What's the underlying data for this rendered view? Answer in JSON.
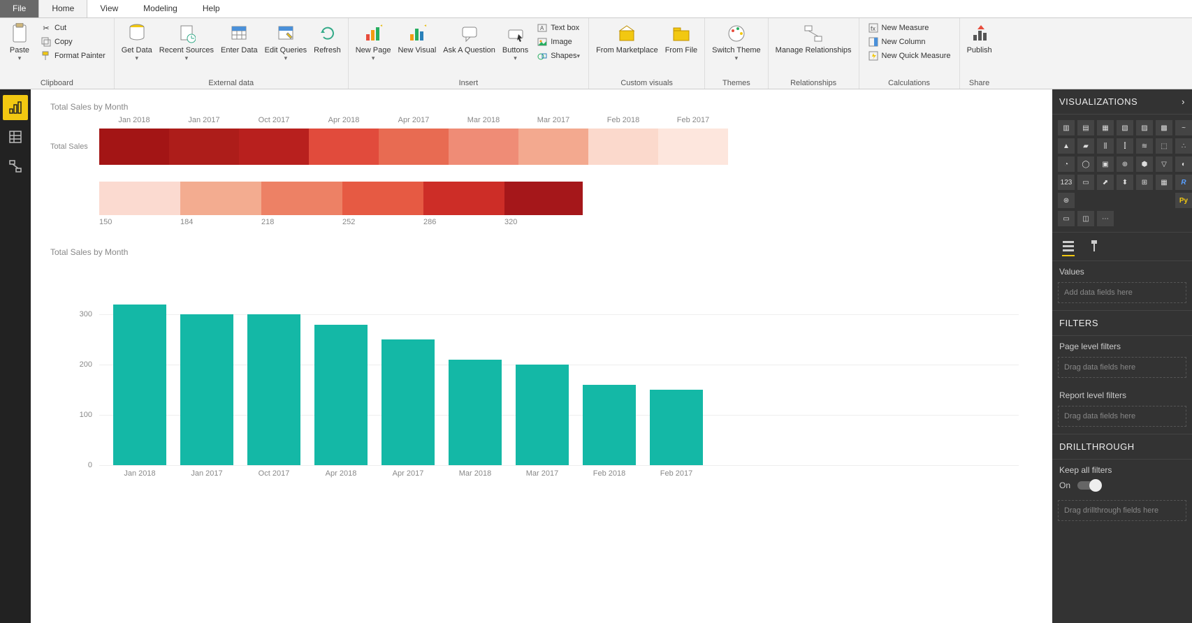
{
  "menubar": {
    "file": "File",
    "tabs": [
      "Home",
      "View",
      "Modeling",
      "Help"
    ],
    "active": "Home"
  },
  "ribbon": {
    "clipboard": {
      "label": "Clipboard",
      "paste": "Paste",
      "cut": "Cut",
      "copy": "Copy",
      "format_painter": "Format Painter"
    },
    "external": {
      "label": "External data",
      "get_data": "Get Data",
      "recent": "Recent Sources",
      "enter": "Enter Data",
      "edit": "Edit Queries",
      "refresh": "Refresh"
    },
    "insert": {
      "label": "Insert",
      "new_page": "New Page",
      "new_visual": "New Visual",
      "ask": "Ask A Question",
      "buttons": "Buttons",
      "textbox": "Text box",
      "image": "Image",
      "shapes": "Shapes"
    },
    "custom": {
      "label": "Custom visuals",
      "marketplace": "From Marketplace",
      "file": "From File"
    },
    "themes": {
      "label": "Themes",
      "switch": "Switch Theme"
    },
    "relationships": {
      "label": "Relationships",
      "manage": "Manage Relationships"
    },
    "calc": {
      "label": "Calculations",
      "measure": "New Measure",
      "column": "New Column",
      "quick": "New Quick Measure"
    },
    "share": {
      "label": "Share",
      "publish": "Publish"
    }
  },
  "charts": {
    "heatmap": {
      "title": "Total Sales by Month",
      "ylabel": "Total Sales",
      "categories": [
        "Jan 2018",
        "Jan 2017",
        "Oct 2017",
        "Apr 2018",
        "Apr 2017",
        "Mar 2018",
        "Mar 2017",
        "Feb 2018",
        "Feb 2017"
      ],
      "colors": [
        "#a31515",
        "#ad1d1a",
        "#b8201e",
        "#e14b3c",
        "#e86b52",
        "#ef8c76",
        "#f3a98f",
        "#fbd9cc",
        "#fde6dd"
      ],
      "legend_ticks": [
        "150",
        "184",
        "218",
        "252",
        "286",
        "320"
      ],
      "legend_colors": [
        "#fbdad0",
        "#f3ac90",
        "#ed8165",
        "#e65a43",
        "#cd2d27",
        "#a5171a"
      ]
    },
    "bar": {
      "title": "Total Sales by Month",
      "yaxis": [
        0,
        100,
        200,
        300
      ],
      "ymax": 320,
      "color": "#14b8a6"
    }
  },
  "chart_data": [
    {
      "type": "heatmap",
      "title": "Total Sales by Month",
      "categories": [
        "Jan 2018",
        "Jan 2017",
        "Oct 2017",
        "Apr 2018",
        "Apr 2017",
        "Mar 2018",
        "Mar 2017",
        "Feb 2018",
        "Feb 2017"
      ],
      "series": [
        {
          "name": "Total Sales",
          "values": [
            320,
            300,
            300,
            280,
            250,
            210,
            200,
            160,
            150
          ]
        }
      ],
      "legend_range": [
        150,
        320
      ],
      "xlabel": "",
      "ylabel": ""
    },
    {
      "type": "bar",
      "title": "Total Sales by Month",
      "categories": [
        "Jan 2018",
        "Jan 2017",
        "Oct 2017",
        "Apr 2018",
        "Apr 2017",
        "Mar 2018",
        "Mar 2017",
        "Feb 2018",
        "Feb 2017"
      ],
      "values": [
        320,
        300,
        300,
        280,
        250,
        210,
        200,
        160,
        150
      ],
      "xlabel": "",
      "ylabel": "",
      "ylim": [
        0,
        320
      ]
    }
  ],
  "panel": {
    "viz_title": "VISUALIZATIONS",
    "values_label": "Values",
    "values_placeholder": "Add data fields here",
    "filters_title": "FILTERS",
    "page_filters": "Page level filters",
    "report_filters": "Report level filters",
    "drag_placeholder": "Drag data fields here",
    "drill_title": "DRILLTHROUGH",
    "keep_all": "Keep all filters",
    "on": "On",
    "drill_placeholder": "Drag drillthrough fields here"
  }
}
